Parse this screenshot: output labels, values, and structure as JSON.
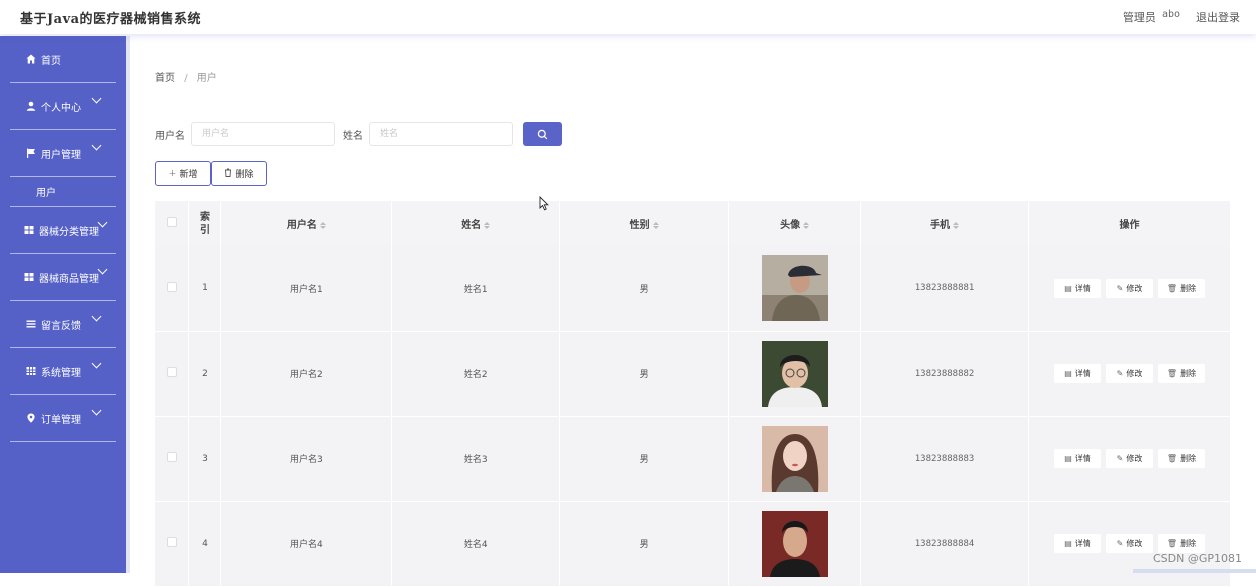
{
  "header": {
    "app_title": "基于Java的医疗器械销售系统",
    "role_label": "管理员",
    "username": "abo",
    "logout_label": "退出登录"
  },
  "sidebar": {
    "items": [
      {
        "label": "首页",
        "icon": "home-icon"
      },
      {
        "label": "个人中心",
        "icon": "user-icon"
      },
      {
        "label": "用户管理",
        "icon": "flag-icon",
        "sub": [
          "用户"
        ]
      },
      {
        "label": "器械分类管理",
        "icon": "grid-icon"
      },
      {
        "label": "器械商品管理",
        "icon": "grid-icon"
      },
      {
        "label": "留言反馈",
        "icon": "list-icon"
      },
      {
        "label": "系统管理",
        "icon": "table-icon"
      },
      {
        "label": "订单管理",
        "icon": "location-icon"
      }
    ],
    "bg_color": "#5561c6"
  },
  "breadcrumb": {
    "home": "首页",
    "separator": "/",
    "current": "用户"
  },
  "search": {
    "username_label": "用户名",
    "username_placeholder": "用户名",
    "name_label": "姓名",
    "name_placeholder": "姓名"
  },
  "actions": {
    "add_label": "新增",
    "delete_label": "删除"
  },
  "table": {
    "headers": {
      "index": "索引",
      "username": "用户名",
      "name": "姓名",
      "gender": "性别",
      "avatar": "头像",
      "phone": "手机",
      "ops": "操作"
    },
    "ops": {
      "detail": "详情",
      "edit": "修改",
      "delete": "删除"
    },
    "rows": [
      {
        "index": "1",
        "username": "用户名1",
        "name": "姓名1",
        "gender": "男",
        "phone": "13823888881"
      },
      {
        "index": "2",
        "username": "用户名2",
        "name": "姓名2",
        "gender": "男",
        "phone": "13823888882"
      },
      {
        "index": "3",
        "username": "用户名3",
        "name": "姓名3",
        "gender": "男",
        "phone": "13823888883"
      },
      {
        "index": "4",
        "username": "用户名4",
        "name": "姓名4",
        "gender": "男",
        "phone": "13823888884"
      }
    ]
  },
  "watermark": "CSDN @GP1081",
  "accent_color": "#5a63c7"
}
